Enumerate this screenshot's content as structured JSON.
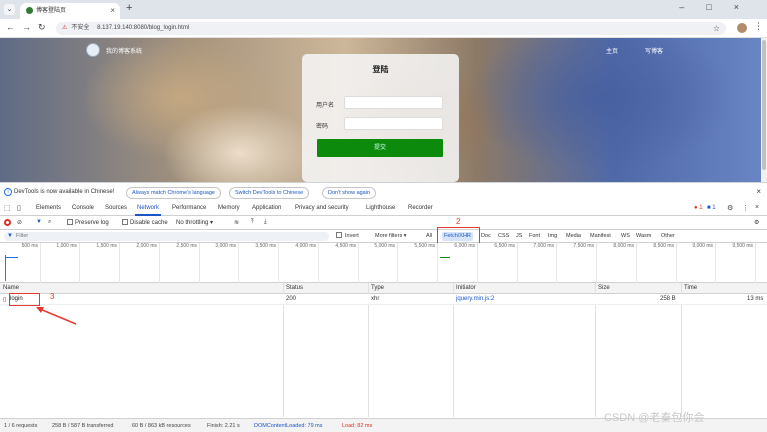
{
  "browser": {
    "tab_title": "博客登陆页",
    "url_warning": "不安全",
    "url": "8.137.19.140:8080/blog_login.html"
  },
  "site": {
    "name": "我的博客系统",
    "nav": [
      "主页",
      "写博客"
    ]
  },
  "login": {
    "title": "登陆",
    "username_label": "用户名",
    "password_label": "密码",
    "username_value": "",
    "password_value": "",
    "submit_label": "提交"
  },
  "devtools": {
    "infobar": {
      "message": "DevTools is now available in Chinese!",
      "buttons": [
        "Always match Chrome's language",
        "Switch DevTools to Chinese",
        "Don't show again"
      ]
    },
    "tabs": [
      "Elements",
      "Console",
      "Sources",
      "Network",
      "Performance",
      "Memory",
      "Application",
      "Privacy and security",
      "Lighthouse",
      "Recorder"
    ],
    "active_tab": "Network",
    "error_count": "1",
    "message_count": "1",
    "toolbar": {
      "preserve_log": "Preserve log",
      "disable_cache": "Disable cache",
      "throttling": "No throttling"
    },
    "filter": {
      "placeholder": "Filter",
      "invert": "Invert",
      "more_filters": "More filters",
      "types": [
        "All",
        "Fetch/XHR",
        "Doc",
        "CSS",
        "JS",
        "Font",
        "Img",
        "Media",
        "Manifest",
        "WS",
        "Wasm",
        "Other"
      ],
      "selected_type": "Fetch/XHR"
    },
    "timeline_ticks": [
      "500 ms",
      "1,000 ms",
      "1,500 ms",
      "2,000 ms",
      "2,500 ms",
      "3,000 ms",
      "3,500 ms",
      "4,000 ms",
      "4,500 ms",
      "5,000 ms",
      "5,500 ms",
      "6,000 ms",
      "6,500 ms",
      "7,000 ms",
      "7,500 ms",
      "8,000 ms",
      "8,500 ms",
      "9,000 ms",
      "9,500 ms"
    ],
    "columns": [
      "Name",
      "Status",
      "Type",
      "Initiator",
      "Size",
      "Time"
    ],
    "rows": [
      {
        "name": "login",
        "status": "200",
        "type": "xhr",
        "initiator": "jquery.min.js:2",
        "size": "258 B",
        "time": "13 ms"
      }
    ],
    "status": {
      "requests": "1 / 6 requests",
      "transferred": "258 B / 587 B transferred",
      "resources": "60 B / 863 kB resources",
      "finish": "Finish: 2.21 s",
      "dom_loaded": "DOMContentLoaded: 79 ms",
      "load": "Load: 82 ms"
    }
  },
  "annotations": [
    "2",
    "3"
  ],
  "watermark": "CSDN @老秦包你会"
}
